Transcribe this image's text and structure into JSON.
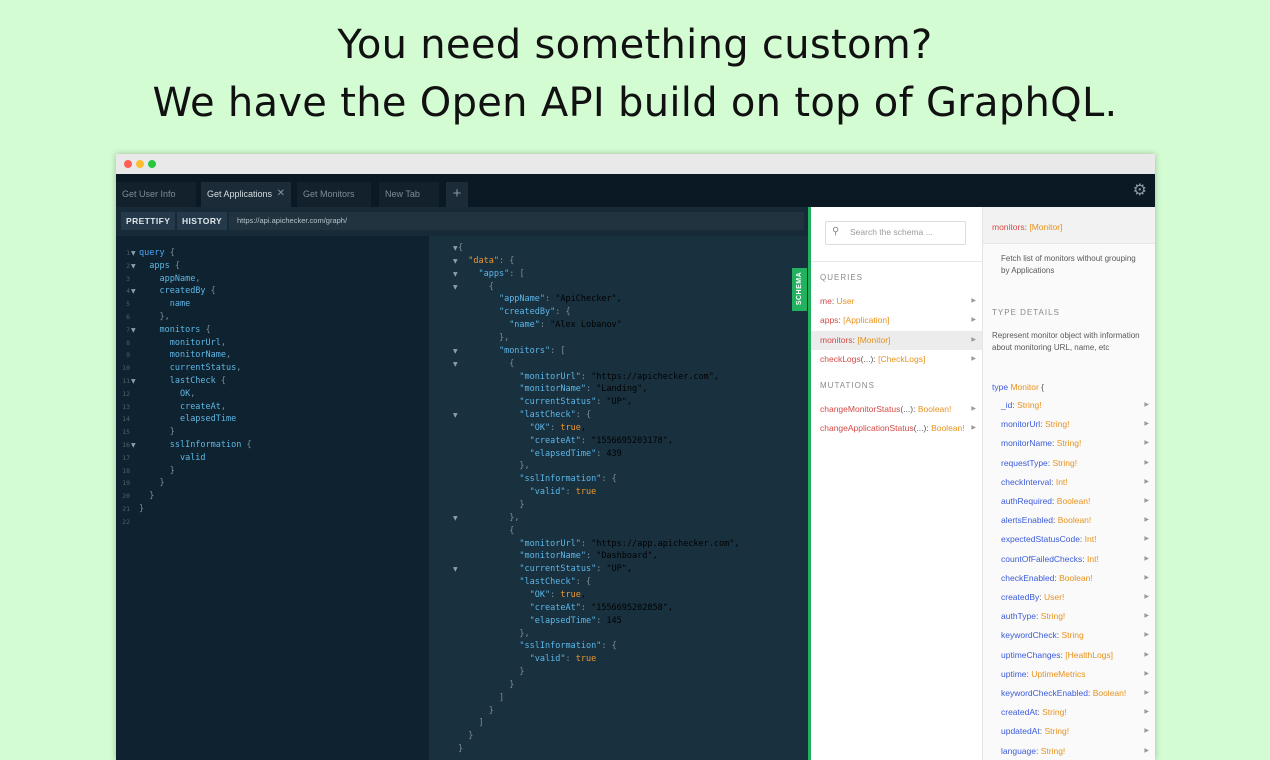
{
  "headline": {
    "line1": "You need something custom?",
    "line2": "We have the Open API build on top of GraphQL."
  },
  "tabs": [
    {
      "label": "Get User Info",
      "active": false
    },
    {
      "label": "Get Applications",
      "active": true
    },
    {
      "label": "Get Monitors",
      "active": false
    },
    {
      "label": "New Tab",
      "active": false
    }
  ],
  "icons": {
    "add_tab": "plus-icon",
    "settings": "gear-icon",
    "search": "search-icon",
    "close_tab": "close-icon",
    "expand": "triangle-right-icon",
    "fold": "triangle-down-icon"
  },
  "toolbar": {
    "prettify": "PRETTIFY",
    "history": "HISTORY",
    "url": "https://api.apichecker.com/graph/"
  },
  "query_lines": [
    "query {",
    "  apps {",
    "    appName,",
    "    createdBy {",
    "      name",
    "    },",
    "    monitors {",
    "      monitorUrl,",
    "      monitorName,",
    "      currentStatus,",
    "      lastCheck {",
    "        OK,",
    "        createAt,",
    "        elapsedTime",
    "      }",
    "      sslInformation {",
    "        valid",
    "      }",
    "    }",
    "  }",
    "}",
    ""
  ],
  "result_lines": [
    "{",
    "  \"data\": {",
    "    \"apps\": [",
    "      {",
    "        \"appName\": \"ApiChecker\",",
    "        \"createdBy\": {",
    "          \"name\": \"Alex Lobanov\"",
    "        },",
    "        \"monitors\": [",
    "          {",
    "            \"monitorUrl\": \"https://apichecker.com\",",
    "            \"monitorName\": \"Landing\",",
    "            \"currentStatus\": \"UP\",",
    "            \"lastCheck\": {",
    "              \"OK\": true,",
    "              \"createAt\": \"1556695203178\",",
    "              \"elapsedTime\": 439",
    "            },",
    "            \"sslInformation\": {",
    "              \"valid\": true",
    "            }",
    "          },",
    "          {",
    "            \"monitorUrl\": \"https://app.apichecker.com\",",
    "            \"monitorName\": \"Dashboard\",",
    "            \"currentStatus\": \"UP\",",
    "            \"lastCheck\": {",
    "              \"OK\": true,",
    "              \"createAt\": \"1556695202858\",",
    "              \"elapsedTime\": 145",
    "            },",
    "            \"sslInformation\": {",
    "              \"valid\": true",
    "            }",
    "          }",
    "        ]",
    "      }",
    "    ]",
    "  }",
    "}"
  ],
  "schema_tab": "SCHEMA",
  "explorer": {
    "search_placeholder": "Search the schema ...",
    "queries_title": "QUERIES",
    "queries": [
      {
        "name": "me",
        "args": "",
        "type": "User",
        "selected": false
      },
      {
        "name": "apps",
        "args": "",
        "type": "[Application]",
        "selected": false
      },
      {
        "name": "monitors",
        "args": "",
        "type": "[Monitor]",
        "selected": true
      },
      {
        "name": "checkLogs",
        "args": "(...)",
        "type": "[CheckLogs]",
        "selected": false
      }
    ],
    "mutations_title": "MUTATIONS",
    "mutations": [
      {
        "name": "changeMonitorStatus",
        "args": "(...)",
        "type": "Boolean!"
      },
      {
        "name": "changeApplicationStatus",
        "args": "(...)",
        "type": "Boolean!"
      }
    ]
  },
  "details": {
    "field_name": "monitors",
    "field_type": "[Monitor]",
    "description": "Fetch list of monitors without grouping by Applications",
    "type_details_title": "TYPE DETAILS",
    "type_description": "Represent monitor object with information about monitoring URL, name, etc",
    "type_keyword": "type",
    "type_name": "Monitor",
    "type_open": "{",
    "fields": [
      {
        "name": "_id",
        "type": "String!"
      },
      {
        "name": "monitorUrl",
        "type": "String!"
      },
      {
        "name": "monitorName",
        "type": "String!"
      },
      {
        "name": "requestType",
        "type": "String!"
      },
      {
        "name": "checkInterval",
        "type": "Int!"
      },
      {
        "name": "authRequired",
        "type": "Boolean!"
      },
      {
        "name": "alertsEnabled",
        "type": "Boolean!"
      },
      {
        "name": "expectedStatusCode",
        "type": "Int!"
      },
      {
        "name": "countOfFailedChecks",
        "type": "Int!"
      },
      {
        "name": "checkEnabled",
        "type": "Boolean!"
      },
      {
        "name": "createdBy",
        "type": "User!"
      },
      {
        "name": "authType",
        "type": "String!"
      },
      {
        "name": "keywordCheck",
        "type": "String"
      },
      {
        "name": "uptimeChanges",
        "type": "[HealthLogs]"
      },
      {
        "name": "uptime",
        "type": "UptimeMetrics"
      },
      {
        "name": "keywordCheckEnabled",
        "type": "Boolean!"
      },
      {
        "name": "createdAt",
        "type": "String!"
      },
      {
        "name": "updatedAt",
        "type": "String!"
      },
      {
        "name": "language",
        "type": "String!"
      }
    ]
  }
}
